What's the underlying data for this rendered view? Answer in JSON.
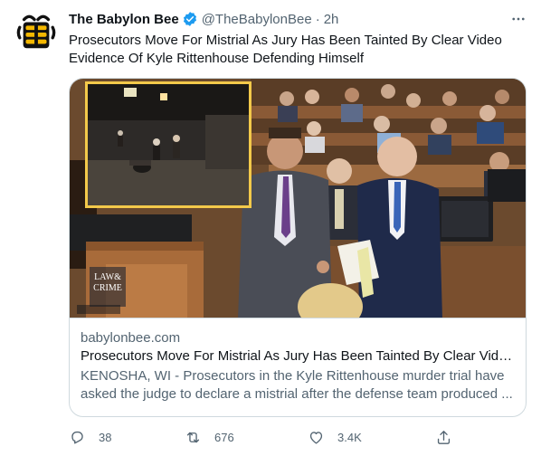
{
  "account": {
    "name": "The Babylon Bee",
    "handle": "@TheBabylonBee",
    "separator": "·",
    "time": "2h"
  },
  "tweet": {
    "text": "Prosecutors Move For Mistrial As Jury Has Been Tainted By Clear Video Evidence Of Kyle Rittenhouse Defending Himself"
  },
  "card": {
    "image_overlay": {
      "logo_line1": "LAW&",
      "logo_line2": "CRIME"
    },
    "domain": "babylonbee.com",
    "title": "Prosecutors Move For Mistrial As Jury Has Been Tainted By Clear Video Evidence Of Kyle Rittenhouse Defending Himself",
    "description": "KENOSHA, WI - Prosecutors in the Kyle Rittenhouse murder trial have asked the judge to declare a mistrial after the defense team produced ..."
  },
  "actions": {
    "reply_count": "38",
    "retweet_count": "676",
    "like_count": "3.4K"
  },
  "icons": {
    "avatar": "babylon-bee-logo",
    "verified": "verified-badge-icon",
    "more": "more-icon",
    "reply": "reply-icon",
    "retweet": "retweet-icon",
    "like": "like-icon",
    "share": "share-icon"
  },
  "colors": {
    "text_primary": "#0f1419",
    "text_secondary": "#536471",
    "verified": "#1d9bf0",
    "border": "#cfd9de"
  }
}
